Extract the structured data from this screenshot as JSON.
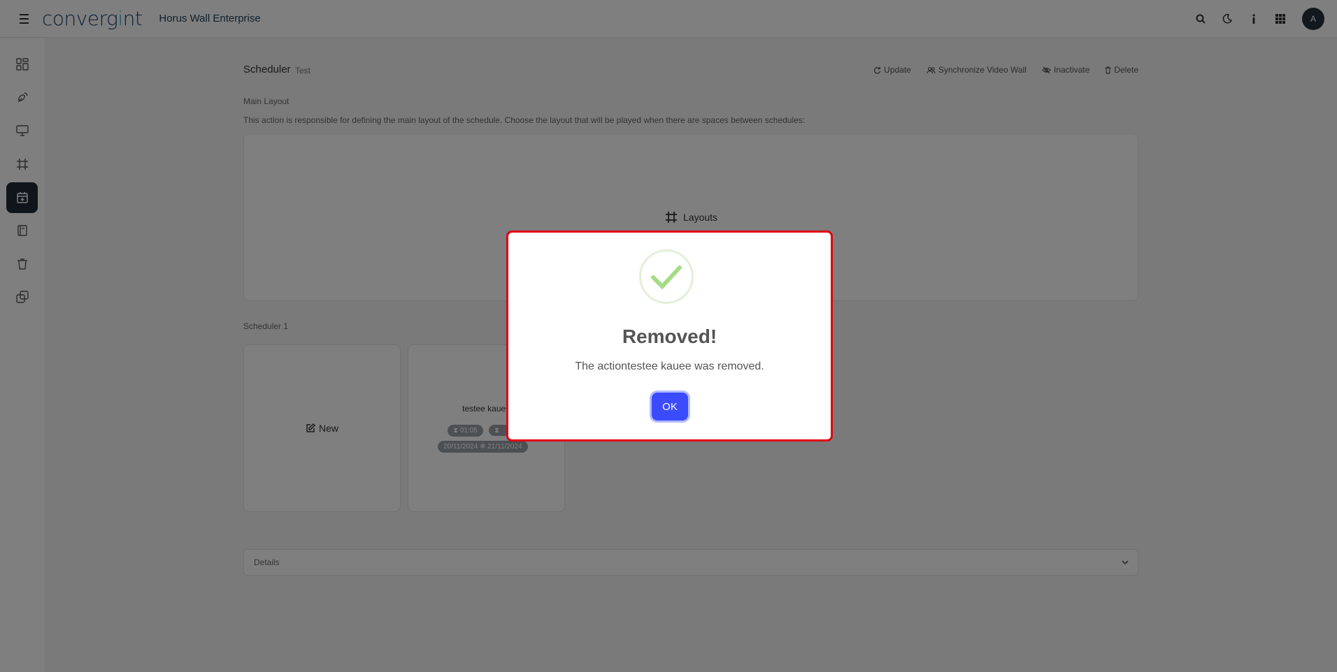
{
  "header": {
    "logo_text": "convergint",
    "app_title": "Horus Wall Enterprise",
    "user_initial": "A",
    "icons": [
      "search-icon",
      "moon-icon",
      "info-icon",
      "apps-grid-icon"
    ]
  },
  "sidebar": {
    "items": [
      {
        "icon": "dashboard-icon"
      },
      {
        "icon": "satellite-icon"
      },
      {
        "icon": "monitor-icon"
      },
      {
        "icon": "layout-frame-icon"
      },
      {
        "icon": "calendar-icon",
        "active": true
      },
      {
        "icon": "book-icon"
      },
      {
        "icon": "trash-icon"
      },
      {
        "icon": "copy-icon"
      }
    ]
  },
  "page": {
    "title": "Scheduler",
    "subtitle": "Test",
    "actions": {
      "update": "Update",
      "sync": "Synchronize Video Wall",
      "inactivate": "Inactivate",
      "delete": "Delete"
    },
    "main_layout_label": "Main Layout",
    "main_layout_desc": "This action is responsible for defining the main layout of the schedule. Choose the layout that will be played when there are spaces between schedules:",
    "layouts_button": "Layouts",
    "scheduler_label": "Scheduler 1",
    "new_button": "New",
    "card": {
      "title": "testee kauee",
      "duration": "01:05",
      "dates": "20/11/2024 ❄ 21/11/2024"
    },
    "details_label": "Details"
  },
  "modal": {
    "title": "Removed!",
    "text": "The actiontestee kauee was removed.",
    "ok_label": "OK",
    "success_color": "#a5dc86",
    "button_color": "#3b4bff"
  }
}
